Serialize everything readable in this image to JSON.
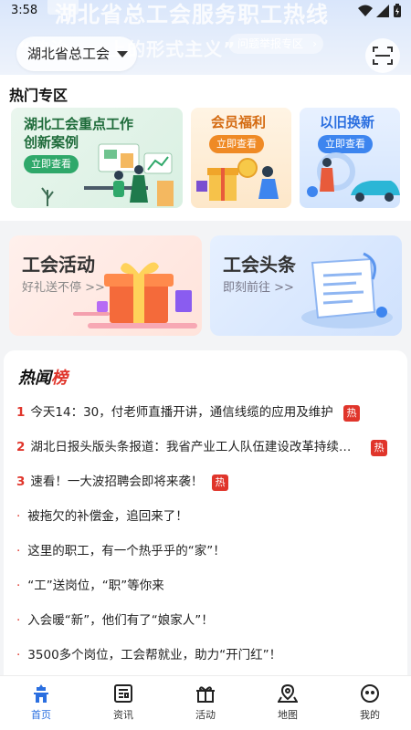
{
  "status": {
    "time": "3:58"
  },
  "banner": {
    "faded_title": "湖北省总工会服务职工热线",
    "slogan": "“整治……上的形式主义”",
    "report_link": "问题举报专区",
    "report_arrow": "›"
  },
  "header": {
    "location": "湖北省总工会"
  },
  "hot_zone": {
    "title": "热门专区",
    "cards": [
      {
        "title": "湖北工会重点工作\n创新案例",
        "button": "立即查看"
      },
      {
        "title": "会员福利",
        "button": "立即查看"
      },
      {
        "title": "以旧换新",
        "button": "立即查看"
      }
    ]
  },
  "activities": [
    {
      "title": "工会活动",
      "subtitle": "好礼送不停 >>"
    },
    {
      "title": "工会头条",
      "subtitle": "即刻前往 >>"
    }
  ],
  "news": {
    "title_part1": "热闻",
    "title_part2": "榜",
    "hot_label": "热",
    "items": [
      {
        "rank": "1",
        "text": "今天14：30，付老师直播开讲，通信线缆的应用及维护",
        "hot": true
      },
      {
        "rank": "2",
        "text": "湖北日报头版头条报道：我省产业工人队伍建设改革持续…",
        "hot": true
      },
      {
        "rank": "3",
        "text": "速看！一大波招聘会即将来袭！",
        "hot": true
      },
      {
        "rank": "·",
        "text": "被拖欠的补偿金，追回来了！",
        "hot": false
      },
      {
        "rank": "·",
        "text": "这里的职工，有一个热乎乎的“家”！",
        "hot": false
      },
      {
        "rank": "·",
        "text": "“工”送岗位，“职”等你来",
        "hot": false
      },
      {
        "rank": "·",
        "text": "入会暖“新”，他们有了“娘家人”！",
        "hot": false
      },
      {
        "rank": "·",
        "text": "3500多个岗位，工会帮就业，助力“开门红”！",
        "hot": false
      }
    ]
  },
  "tabs": [
    {
      "label": "首页",
      "icon": "home-icon",
      "active": true
    },
    {
      "label": "资讯",
      "icon": "news-icon",
      "active": false
    },
    {
      "label": "活动",
      "icon": "gift-icon",
      "active": false
    },
    {
      "label": "地图",
      "icon": "map-icon",
      "active": false
    },
    {
      "label": "我的",
      "icon": "profile-icon",
      "active": false
    }
  ],
  "colors": {
    "accent": "#2b6fe0",
    "hot_red": "#e0352b",
    "green": "#2fa86a",
    "orange": "#ef8a25"
  }
}
